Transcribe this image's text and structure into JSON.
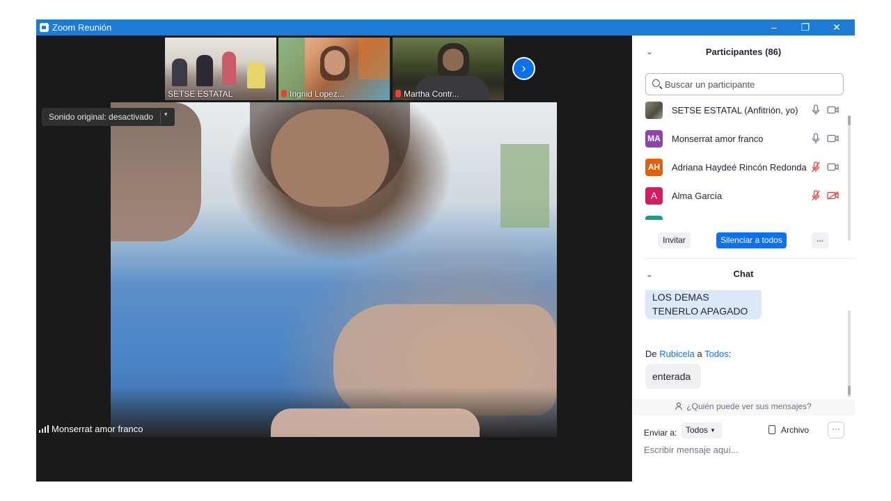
{
  "window": {
    "title": "Zoom Reunión",
    "minimize": "–",
    "maximize": "❐",
    "close": "✕"
  },
  "thumbnails": [
    {
      "label": "SETSE ESTATAL",
      "muted": false
    },
    {
      "label": "Ingriid Lopez...",
      "muted": true
    },
    {
      "label": "Martha Contr...",
      "muted": true
    }
  ],
  "next_button": "›",
  "audio": {
    "label": "Sonido original: desactivado",
    "caret": "▾"
  },
  "active_speaker": "Monserrat amor franco",
  "participants": {
    "header": "Participantes (86)",
    "search_placeholder": "Buscar un participante",
    "list": [
      {
        "initials": "",
        "name": "SETSE ESTATAL (Anfitrión, yo)",
        "color": "#6b6b5a",
        "mic_muted": false,
        "video_off": false
      },
      {
        "initials": "MA",
        "name": "Monserrat amor franco",
        "color": "#8e44ad",
        "mic_muted": false,
        "video_off": false
      },
      {
        "initials": "AH",
        "name": "Adriana Haydeé Rincón Redonda",
        "color": "#e0610b",
        "mic_muted": true,
        "video_off": false
      },
      {
        "initials": "A",
        "name": "Alma García",
        "color": "#d81b60",
        "mic_muted": true,
        "video_off": true
      }
    ],
    "buttons": {
      "invite": "Invitar",
      "mute_all": "Silenciar a todos",
      "more": "..."
    }
  },
  "chat": {
    "header": "Chat",
    "messages": [
      {
        "text": "LOS DEMAS TENERLO APAGADO"
      },
      {
        "from_prefix": "De",
        "from": "Rubicela",
        "to_word": "a",
        "to": "Todos",
        "suffix": ":",
        "text": "enterada"
      }
    ],
    "who_can_see": "¿Quién puede ver sus mensajes?",
    "send_to_label": "Enviar a:",
    "send_to_value": "Todos",
    "file_label": "Archivo",
    "more": "···",
    "input_placeholder": "Escribir mensaje aquí..."
  },
  "colors": {
    "titlebar": "#1f7ad4",
    "accent": "#0e71eb",
    "muted": "#e8413c",
    "video_bg": "#1a1a1a"
  }
}
